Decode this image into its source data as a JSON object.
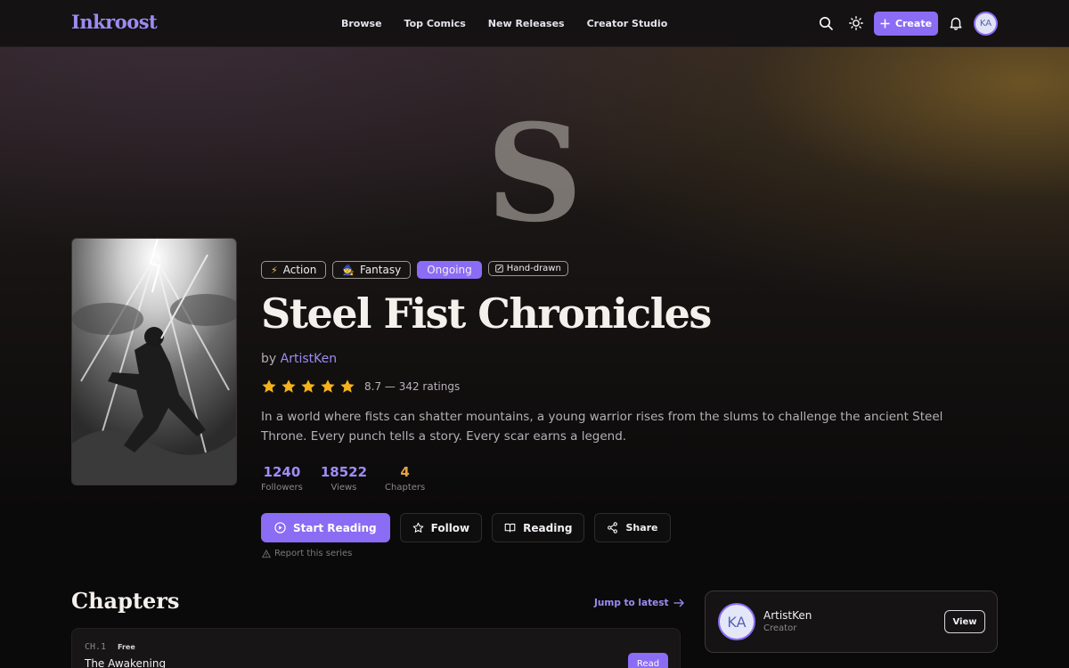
{
  "app": {
    "logo": "Inkroost"
  },
  "nav": {
    "items": [
      "Browse",
      "Top Comics",
      "New Releases",
      "Creator Studio"
    ],
    "create_label": "Create",
    "avatar_initials": "KA"
  },
  "hero": {
    "letter": "S",
    "tags": [
      {
        "icon": "lightning-icon",
        "label": "Action"
      },
      {
        "icon": "wizard-icon",
        "label": "Fantasy"
      },
      {
        "label": "Ongoing"
      },
      {
        "icon": "pencil-icon",
        "label": "Hand-drawn"
      }
    ],
    "title": "Steel Fist Chronicles",
    "by_prefix": "by",
    "author": "ArtistKen",
    "rating": {
      "stars": 5,
      "text": "8.7 — 342 ratings"
    },
    "description": "In a world where fists can shatter mountains, a young warrior rises from the slums to challenge the ancient Steel Throne. Every punch tells a story. Every scar earns a legend.",
    "stats": [
      {
        "value": "1240",
        "label": "Followers"
      },
      {
        "value": "18522",
        "label": "Views"
      },
      {
        "value": "4",
        "label": "Chapters"
      }
    ],
    "actions": {
      "start_reading": "Start Reading",
      "follow": "Follow",
      "reading": "Reading",
      "share": "Share"
    },
    "report": "Report this series"
  },
  "chapters": {
    "heading": "Chapters",
    "jump": "Jump to latest",
    "items": [
      {
        "num": "CH.1",
        "badge": "Free",
        "title": "The Awakening",
        "action": "Read"
      }
    ]
  },
  "creator": {
    "initials": "KA",
    "name": "ArtistKen",
    "role": "Creator",
    "view": "View"
  },
  "colors": {
    "accent": "#8b6cf4",
    "star": "#f5b21b",
    "chapters_stat": "#e6a344"
  }
}
